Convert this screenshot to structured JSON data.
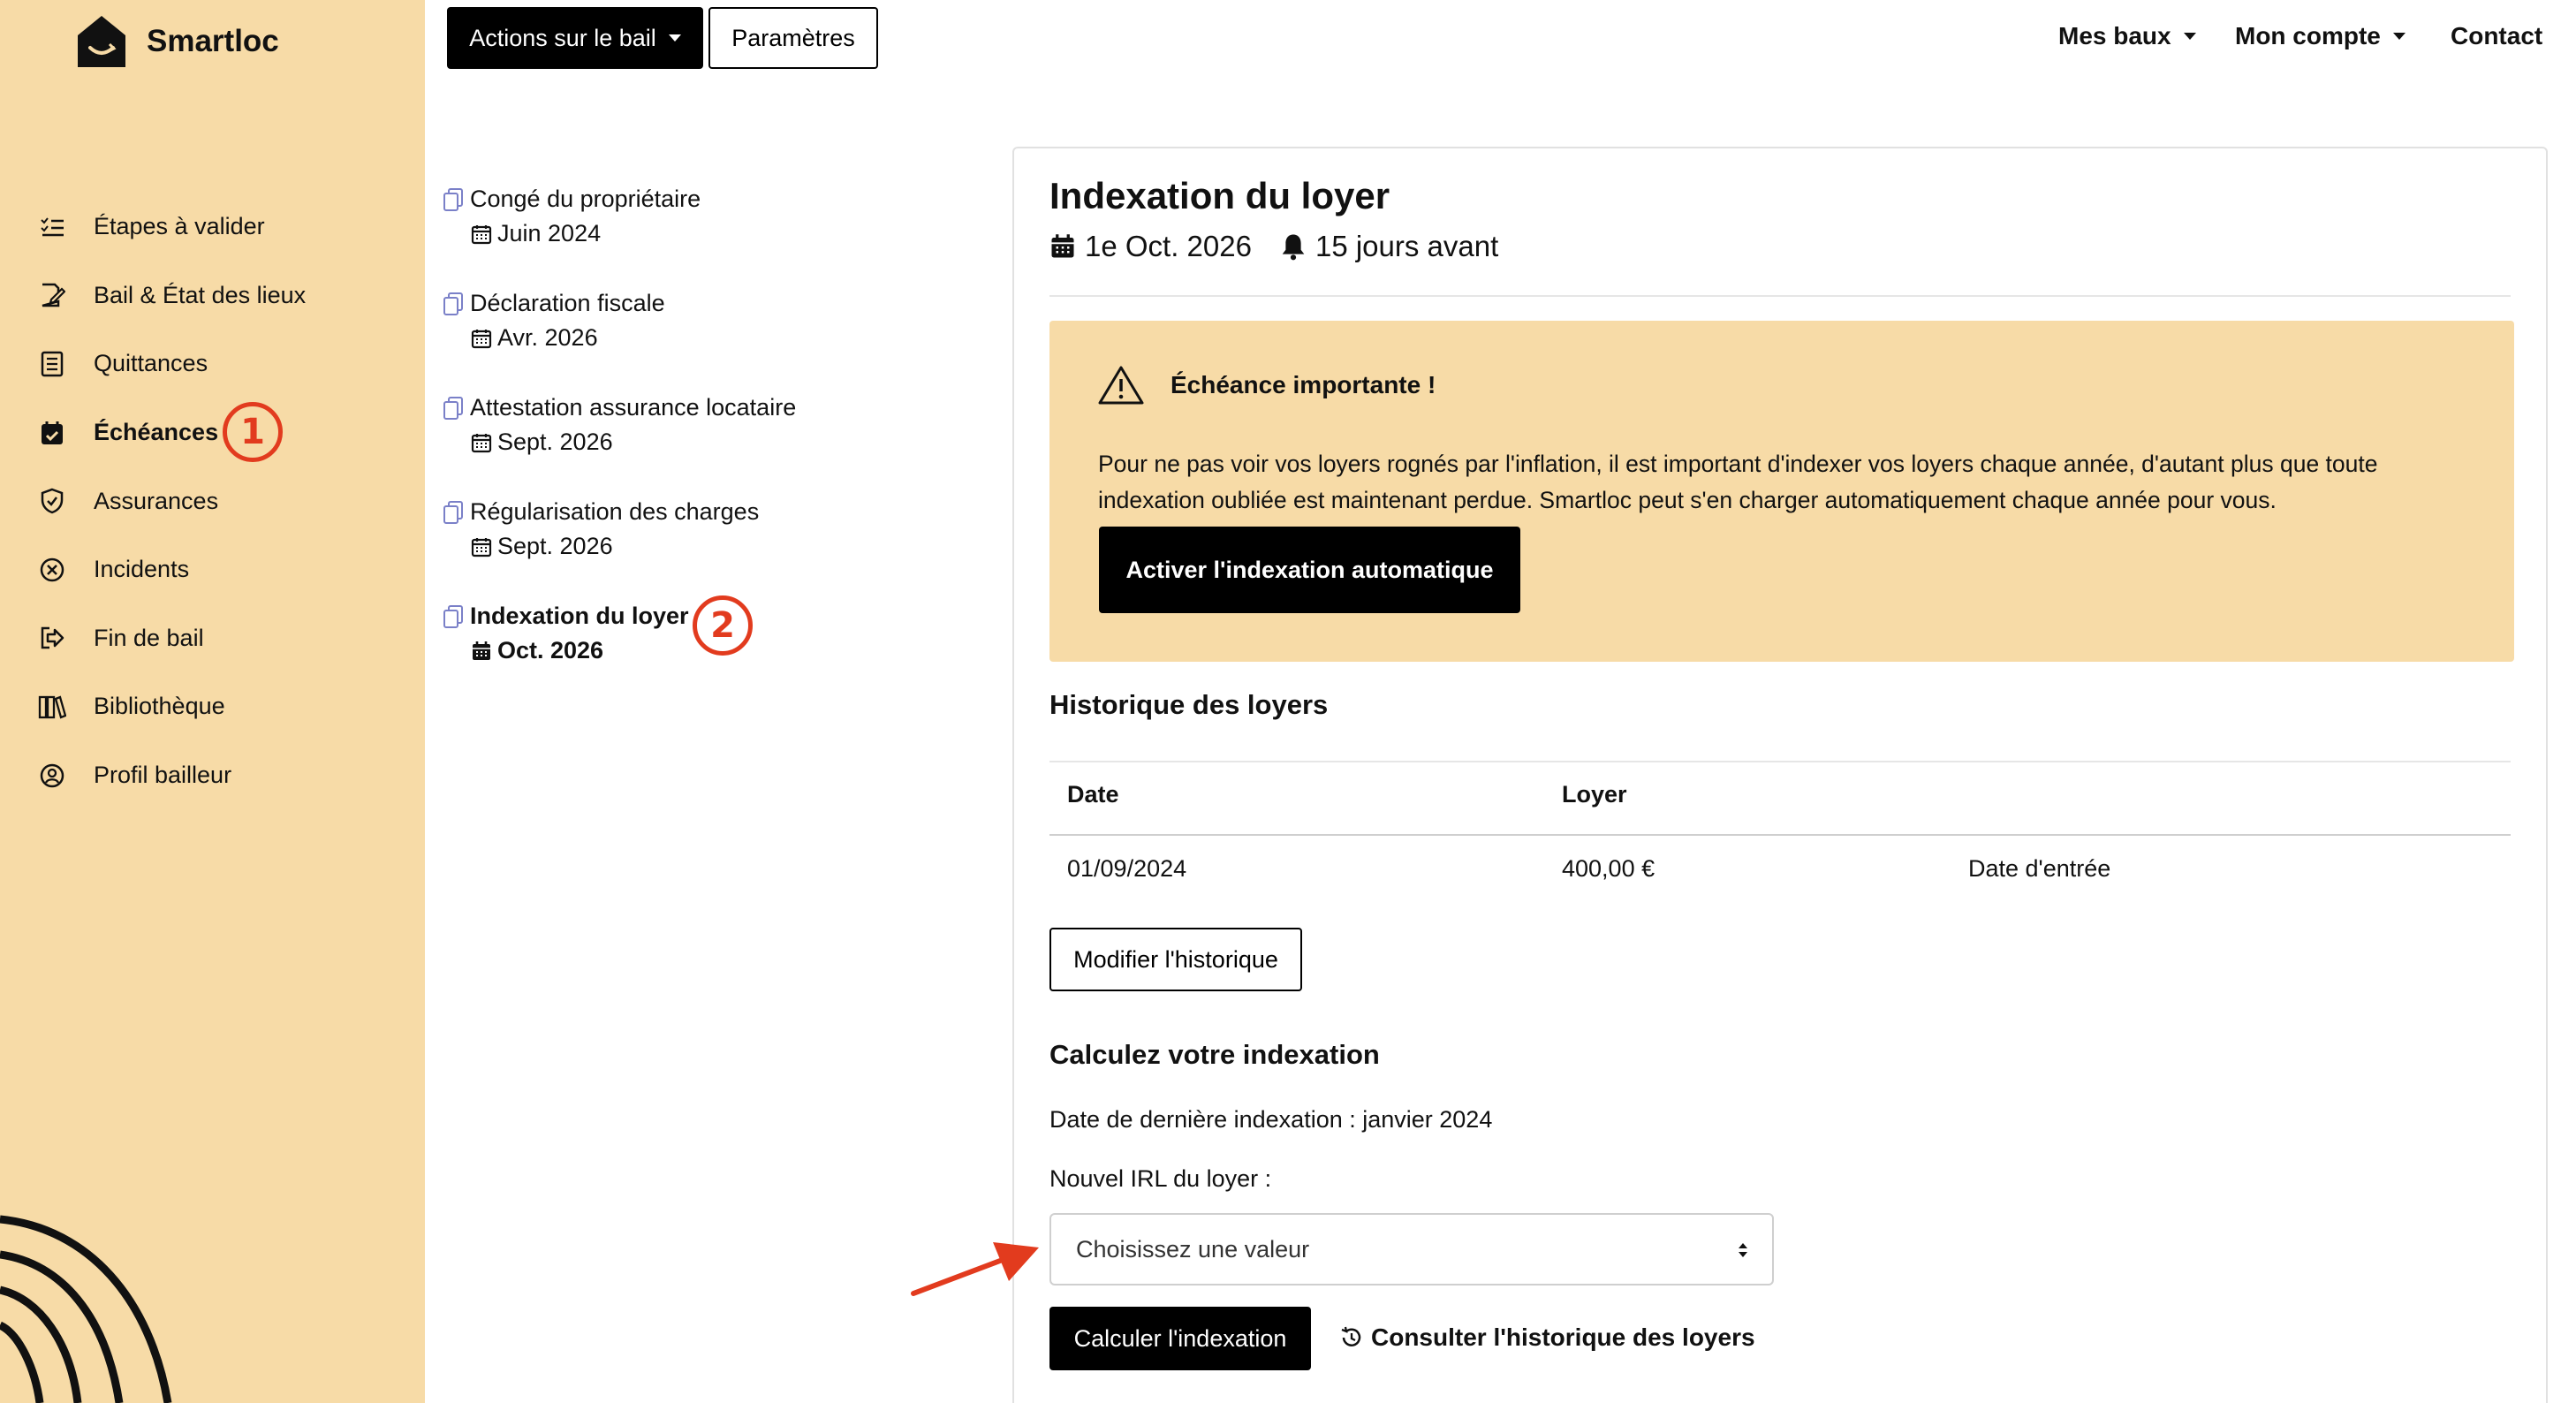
{
  "app": {
    "name": "Smartloc"
  },
  "sidebar": {
    "items": [
      {
        "label": "Étapes à valider",
        "icon": "checklist-icon"
      },
      {
        "label": "Bail & État des lieux",
        "icon": "edit-document-icon"
      },
      {
        "label": "Quittances",
        "icon": "receipt-icon"
      },
      {
        "label": "Échéances",
        "icon": "calendar-check-icon",
        "active": true
      },
      {
        "label": "Assurances",
        "icon": "shield-icon"
      },
      {
        "label": "Incidents",
        "icon": "x-circle-icon"
      },
      {
        "label": "Fin de bail",
        "icon": "exit-icon"
      },
      {
        "label": "Bibliothèque",
        "icon": "books-icon"
      },
      {
        "label": "Profil bailleur",
        "icon": "user-circle-icon"
      }
    ],
    "annotation_1": "1"
  },
  "header": {
    "actions_button": "Actions sur le bail",
    "settings_button": "Paramètres",
    "nav": {
      "leases": "Mes baux",
      "account": "Mon compte",
      "contact": "Contact"
    }
  },
  "timeline": {
    "items": [
      {
        "title": "Congé du propriétaire",
        "date": "Juin 2024"
      },
      {
        "title": "Déclaration fiscale",
        "date": "Avr. 2026"
      },
      {
        "title": "Attestation assurance locataire",
        "date": "Sept. 2026"
      },
      {
        "title": "Régularisation des charges",
        "date": "Sept. 2026"
      },
      {
        "title": "Indexation du loyer",
        "date": "Oct. 2026",
        "current": true
      }
    ],
    "annotation_2": "2"
  },
  "detail": {
    "title": "Indexation du loyer",
    "date": "1e Oct. 2026",
    "reminder": "15 jours avant",
    "alert": {
      "heading": "Échéance importante !",
      "text": "Pour ne pas voir vos loyers rognés par l'inflation, il est important d'indexer vos loyers chaque année, d'autant plus que toute indexation oubliée est maintenant perdue. Smartloc peut s'en charger automatiquement chaque année pour vous.",
      "button": "Activer l'indexation automatique"
    },
    "history": {
      "heading": "Historique des loyers",
      "columns": [
        "Date",
        "Loyer"
      ],
      "rows": [
        {
          "date": "01/09/2024",
          "rent": "400,00 €",
          "note": "Date d'entrée"
        }
      ],
      "edit_button": "Modifier l'historique"
    },
    "calc": {
      "heading": "Calculez votre indexation",
      "last_indexation": "Date de dernière indexation : janvier 2024",
      "irl_label": "Nouvel IRL du loyer :",
      "select_placeholder": "Choisissez une valeur",
      "calc_button": "Calculer l'indexation",
      "history_link": "Consulter l'historique des loyers"
    }
  },
  "colors": {
    "sidebar_bg": "#f7dba7",
    "accent_red": "#e23b1e",
    "button_dark": "#000000"
  }
}
